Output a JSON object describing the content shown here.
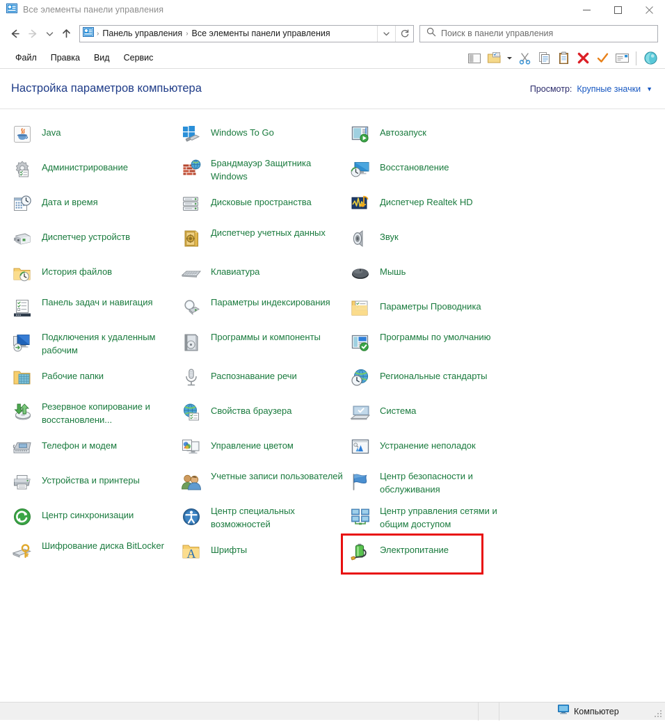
{
  "window": {
    "title": "Все элементы панели управления",
    "title_icon": "control-panel-icon",
    "minimize_label": "—",
    "maximize_label": "□",
    "close_label": "✕"
  },
  "nav": {
    "back_icon": "arrow-left-icon",
    "forward_icon": "arrow-right-icon",
    "recent_icon": "chevron-down-icon",
    "up_icon": "arrow-up-icon",
    "address_icon": "control-panel-icon",
    "breadcrumb": [
      "Панель управления",
      "Все элементы панели управления"
    ],
    "separator": "›",
    "dropdown_icon": "chevron-down-icon",
    "refresh_icon": "refresh-icon"
  },
  "search": {
    "icon": "search-icon",
    "placeholder": "Поиск в панели управления",
    "value": ""
  },
  "menu": {
    "items": [
      "Файл",
      "Правка",
      "Вид",
      "Сервис"
    ]
  },
  "toolbar": {
    "buttons": [
      {
        "name": "layout-pane-icon",
        "label": "Область сведений"
      },
      {
        "name": "new-folder-icon",
        "label": "Новая папка"
      },
      {
        "name": "chevron-down-icon",
        "label": "Дополнительно"
      },
      {
        "name": "cut-scissors-icon",
        "label": "Вырезать"
      },
      {
        "name": "copy-icon",
        "label": "Копировать"
      },
      {
        "name": "paste-clipboard-icon",
        "label": "Вставить"
      },
      {
        "name": "delete-x-icon",
        "label": "Удалить"
      },
      {
        "name": "checkmark-icon",
        "label": "Подтвердить"
      },
      {
        "name": "rename-properties-icon",
        "label": "Переименовать"
      },
      {
        "name": "shell-help-icon",
        "label": "Справка"
      }
    ]
  },
  "header": {
    "title": "Настройка параметров компьютера",
    "view_label": "Просмотр:",
    "view_value": "Крупные значки",
    "view_caret": "▼"
  },
  "items": {
    "column1": [
      {
        "label": "Java",
        "icon": "java-icon",
        "lines": 1
      },
      {
        "label": "Администрирование",
        "icon": "admin-tools-icon",
        "lines": 1
      },
      {
        "label": "Дата и время",
        "icon": "date-time-icon",
        "lines": 1
      },
      {
        "label": "Диспетчер устройств",
        "icon": "device-manager-icon",
        "lines": 1
      },
      {
        "label": "История файлов",
        "icon": "file-history-icon",
        "lines": 1
      },
      {
        "label": "Панель задач и навигация",
        "icon": "taskbar-navigation-icon",
        "lines": 2
      },
      {
        "label": "Подключения к удаленным рабочим",
        "icon": "remote-desktop-icon",
        "lines": 2
      },
      {
        "label": "Рабочие папки",
        "icon": "work-folders-icon",
        "lines": 1
      },
      {
        "label": "Резервное копирование и восстановлени...",
        "icon": "backup-restore-icon",
        "lines": 2
      },
      {
        "label": "Телефон и модем",
        "icon": "phone-modem-icon",
        "lines": 1
      },
      {
        "label": "Устройства и принтеры",
        "icon": "devices-printers-icon",
        "lines": 1
      },
      {
        "label": "Центр синхронизации",
        "icon": "sync-center-icon",
        "lines": 1
      },
      {
        "label": "Шифрование диска BitLocker",
        "icon": "bitlocker-icon",
        "lines": 2
      }
    ],
    "column2": [
      {
        "label": "Windows To Go",
        "icon": "windows-to-go-icon",
        "lines": 1
      },
      {
        "label": "Брандмауэр Защитника Windows",
        "icon": "firewall-icon",
        "lines": 2
      },
      {
        "label": "Дисковые пространства",
        "icon": "storage-spaces-icon",
        "lines": 1
      },
      {
        "label": "Диспетчер учетных данных",
        "icon": "credential-manager-icon",
        "lines": 2
      },
      {
        "label": "Клавиатура",
        "icon": "keyboard-icon",
        "lines": 1
      },
      {
        "label": "Параметры индексирования",
        "icon": "indexing-options-icon",
        "lines": 2
      },
      {
        "label": "Программы и компоненты",
        "icon": "programs-features-icon",
        "lines": 2
      },
      {
        "label": "Распознавание речи",
        "icon": "speech-recognition-icon",
        "lines": 1
      },
      {
        "label": "Свойства браузера",
        "icon": "internet-options-icon",
        "lines": 1
      },
      {
        "label": "Управление цветом",
        "icon": "color-management-icon",
        "lines": 1
      },
      {
        "label": "Учетные записи пользователей",
        "icon": "user-accounts-icon",
        "lines": 2
      },
      {
        "label": "Центр специальных возможностей",
        "icon": "ease-of-access-icon",
        "lines": 2
      },
      {
        "label": "Шрифты",
        "icon": "fonts-icon",
        "lines": 1
      }
    ],
    "column3": [
      {
        "label": "Автозапуск",
        "icon": "autoplay-icon",
        "lines": 1
      },
      {
        "label": "Восстановление",
        "icon": "recovery-icon",
        "lines": 1
      },
      {
        "label": "Диспетчер Realtek HD",
        "icon": "realtek-hd-icon",
        "lines": 1
      },
      {
        "label": "Звук",
        "icon": "sound-icon",
        "lines": 1
      },
      {
        "label": "Мышь",
        "icon": "mouse-icon",
        "lines": 1
      },
      {
        "label": "Параметры Проводника",
        "icon": "file-explorer-options-icon",
        "lines": 1
      },
      {
        "label": "Программы по умолчанию",
        "icon": "default-programs-icon",
        "lines": 2
      },
      {
        "label": "Региональные стандарты",
        "icon": "region-icon",
        "lines": 1
      },
      {
        "label": "Система",
        "icon": "system-icon",
        "lines": 1
      },
      {
        "label": "Устранение неполадок",
        "icon": "troubleshooting-icon",
        "lines": 1
      },
      {
        "label": "Центр безопасности и обслуживания",
        "icon": "security-maintenance-icon",
        "lines": 2
      },
      {
        "label": "Центр управления сетями и общим доступом",
        "icon": "network-sharing-center-icon",
        "lines": 2
      },
      {
        "label": "Электропитание",
        "icon": "power-options-icon",
        "lines": 1,
        "highlighted": true
      }
    ]
  },
  "statusbar": {
    "computer_label": "Компьютер",
    "computer_icon": "monitor-icon"
  },
  "colors": {
    "link_green": "#197a3d",
    "header_blue": "#1f3c88",
    "view_link": "#1757c1",
    "highlight_red": "#e81010",
    "title_grey": "#8d8d8d"
  }
}
